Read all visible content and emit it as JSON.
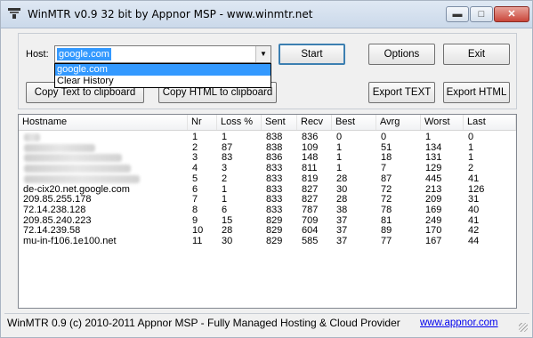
{
  "window": {
    "title": "WinMTR v0.9 32 bit by Appnor MSP - www.winmtr.net"
  },
  "controls": {
    "minimize_glyph": "▬",
    "maximize_glyph": "□",
    "close_glyph": "✕"
  },
  "host": {
    "label": "Host:",
    "value": "google.com",
    "dropdown_options": [
      "google.com",
      "Clear History"
    ],
    "selected_option": "google.com"
  },
  "buttons": {
    "start": "Start",
    "options": "Options",
    "exit": "Exit",
    "copy_text": "Copy Text to clipboard",
    "copy_html": "Copy HTML to clipboard",
    "export_text": "Export TEXT",
    "export_html": "Export HTML"
  },
  "table": {
    "columns": [
      "Hostname",
      "Nr",
      "Loss %",
      "Sent",
      "Recv",
      "Best",
      "Avrg",
      "Worst",
      "Last"
    ],
    "rows": [
      {
        "hostname": "",
        "hidden": true,
        "nr": "1",
        "loss": "1",
        "sent": "838",
        "recv": "836",
        "best": "0",
        "avrg": "0",
        "worst": "1",
        "last": "0"
      },
      {
        "hostname": "",
        "hidden": true,
        "nr": "2",
        "loss": "87",
        "sent": "838",
        "recv": "109",
        "best": "1",
        "avrg": "51",
        "worst": "134",
        "last": "1"
      },
      {
        "hostname": "",
        "hidden": true,
        "nr": "3",
        "loss": "83",
        "sent": "836",
        "recv": "148",
        "best": "1",
        "avrg": "18",
        "worst": "131",
        "last": "1"
      },
      {
        "hostname": "",
        "hidden": true,
        "nr": "4",
        "loss": "3",
        "sent": "833",
        "recv": "811",
        "best": "1",
        "avrg": "7",
        "worst": "129",
        "last": "2"
      },
      {
        "hostname": "",
        "hidden": true,
        "nr": "5",
        "loss": "2",
        "sent": "833",
        "recv": "819",
        "best": "28",
        "avrg": "87",
        "worst": "445",
        "last": "41"
      },
      {
        "hostname": "de-cix20.net.google.com",
        "hidden": false,
        "nr": "6",
        "loss": "1",
        "sent": "833",
        "recv": "827",
        "best": "30",
        "avrg": "72",
        "worst": "213",
        "last": "126"
      },
      {
        "hostname": "209.85.255.178",
        "hidden": false,
        "nr": "7",
        "loss": "1",
        "sent": "833",
        "recv": "827",
        "best": "28",
        "avrg": "72",
        "worst": "209",
        "last": "31"
      },
      {
        "hostname": "72.14.238.128",
        "hidden": false,
        "nr": "8",
        "loss": "6",
        "sent": "833",
        "recv": "787",
        "best": "38",
        "avrg": "78",
        "worst": "169",
        "last": "40"
      },
      {
        "hostname": "209.85.240.223",
        "hidden": false,
        "nr": "9",
        "loss": "15",
        "sent": "829",
        "recv": "709",
        "best": "37",
        "avrg": "81",
        "worst": "249",
        "last": "41"
      },
      {
        "hostname": "72.14.239.58",
        "hidden": false,
        "nr": "10",
        "loss": "28",
        "sent": "829",
        "recv": "604",
        "best": "37",
        "avrg": "89",
        "worst": "170",
        "last": "42"
      },
      {
        "hostname": "mu-in-f106.1e100.net",
        "hidden": false,
        "nr": "11",
        "loss": "30",
        "sent": "829",
        "recv": "585",
        "best": "37",
        "avrg": "77",
        "worst": "167",
        "last": "44"
      }
    ]
  },
  "status": {
    "text": "WinMTR 0.9 (c) 2010-2011 Appnor MSP - Fully Managed Hosting & Cloud Provider",
    "link": "www.appnor.com"
  },
  "colors": {
    "selection": "#3399ff",
    "link": "#0000ee",
    "close_button": "#c9463a"
  }
}
